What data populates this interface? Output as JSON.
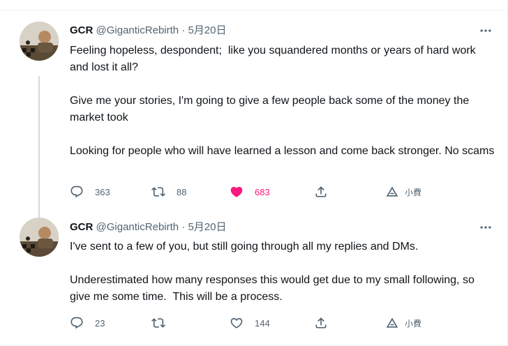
{
  "tweets": [
    {
      "name": "GCR",
      "handle": "@GiganticRebirth",
      "sep": "·",
      "date": "5月20日",
      "text": "Feeling hopeless, despondent;  like you squandered months or years of hard work and lost it all?\n\nGive me your stories, I'm going to give a few people back some of the money the market took\n\nLooking for people who will have learned a lesson and come back stronger. No scams",
      "replies": "363",
      "retweets": "88",
      "likes": "683",
      "tip_label": "小費",
      "liked": true
    },
    {
      "name": "GCR",
      "handle": "@GiganticRebirth",
      "sep": "·",
      "date": "5月20日",
      "text": "I've sent to a few of you, but still going through all my replies and DMs.\n\nUnderestimated how many responses this would get due to my small following, so give me some time.  This will be a process.",
      "replies": "23",
      "retweets": "",
      "likes": "144",
      "tip_label": "小費",
      "liked": false
    }
  ],
  "icons": {
    "more": "more-horizontal-icon",
    "reply": "reply-icon",
    "retweet": "retweet-icon",
    "like": "heart-icon",
    "share": "share-icon",
    "tip": "tip-icon"
  },
  "colors": {
    "like_active": "#f91880",
    "secondary_text": "#536471",
    "primary_text": "#0f1419"
  }
}
